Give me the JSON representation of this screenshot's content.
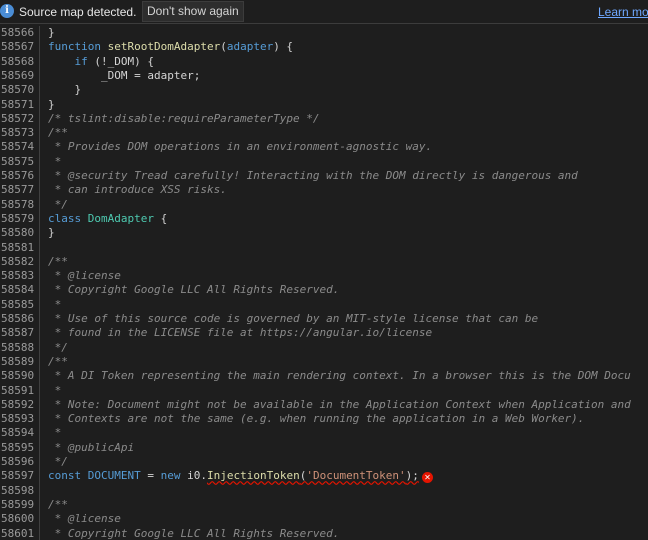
{
  "infobar": {
    "message": "Source map detected.",
    "dont_show_label": "Don't show again",
    "learn_more_label": "Learn mo"
  },
  "editor": {
    "lines": [
      {
        "n": "58566",
        "t": "    }",
        "k": "plain"
      },
      {
        "n": "58567",
        "t": "    function setRootDomAdapter(adapter) {",
        "k": "fn-decl"
      },
      {
        "n": "58568",
        "t": "        if (!_DOM) {",
        "k": "if"
      },
      {
        "n": "58569",
        "t": "            _DOM = adapter;",
        "k": "plain"
      },
      {
        "n": "58570",
        "t": "        }",
        "k": "plain"
      },
      {
        "n": "58571",
        "t": "    }",
        "k": "plain"
      },
      {
        "n": "58572",
        "t": "    /* tslint:disable:requireParameterType */",
        "k": "comment"
      },
      {
        "n": "58573",
        "t": "    /**",
        "k": "comment"
      },
      {
        "n": "58574",
        "t": "     * Provides DOM operations in an environment-agnostic way.",
        "k": "comment"
      },
      {
        "n": "58575",
        "t": "     *",
        "k": "comment"
      },
      {
        "n": "58576",
        "t": "     * @security Tread carefully! Interacting with the DOM directly is dangerous and",
        "k": "comment"
      },
      {
        "n": "58577",
        "t": "     * can introduce XSS risks.",
        "k": "comment"
      },
      {
        "n": "58578",
        "t": "     */",
        "k": "comment"
      },
      {
        "n": "58579",
        "t": "    class DomAdapter {",
        "k": "class"
      },
      {
        "n": "58580",
        "t": "    }",
        "k": "plain"
      },
      {
        "n": "58581",
        "t": "",
        "k": "plain"
      },
      {
        "n": "58582",
        "t": "    /**",
        "k": "comment"
      },
      {
        "n": "58583",
        "t": "     * @license",
        "k": "comment"
      },
      {
        "n": "58584",
        "t": "     * Copyright Google LLC All Rights Reserved.",
        "k": "comment"
      },
      {
        "n": "58585",
        "t": "     *",
        "k": "comment"
      },
      {
        "n": "58586",
        "t": "     * Use of this source code is governed by an MIT-style license that can be",
        "k": "comment"
      },
      {
        "n": "58587",
        "t": "     * found in the LICENSE file at https://angular.io/license",
        "k": "comment"
      },
      {
        "n": "58588",
        "t": "     */",
        "k": "comment"
      },
      {
        "n": "58589",
        "t": "    /**",
        "k": "comment"
      },
      {
        "n": "58590",
        "t": "     * A DI Token representing the main rendering context. In a browser this is the DOM Docu",
        "k": "comment"
      },
      {
        "n": "58591",
        "t": "     *",
        "k": "comment"
      },
      {
        "n": "58592",
        "t": "     * Note: Document might not be available in the Application Context when Application and",
        "k": "comment"
      },
      {
        "n": "58593",
        "t": "     * Contexts are not the same (e.g. when running the application in a Web Worker).",
        "k": "comment"
      },
      {
        "n": "58594",
        "t": "     *",
        "k": "comment"
      },
      {
        "n": "58595",
        "t": "     * @publicApi",
        "k": "comment"
      },
      {
        "n": "58596",
        "t": "     */",
        "k": "comment"
      },
      {
        "n": "58597",
        "t": "    const DOCUMENT = new i0.InjectionToken('DocumentToken');",
        "k": "error"
      },
      {
        "n": "58598",
        "t": "",
        "k": "plain"
      },
      {
        "n": "58599",
        "t": "    /**",
        "k": "comment"
      },
      {
        "n": "58600",
        "t": "     * @license",
        "k": "comment"
      },
      {
        "n": "58601",
        "t": "     * Copyright Google LLC All Rights Reserved.",
        "k": "comment"
      }
    ]
  },
  "colors": {
    "background": "#1e1e1e",
    "keyword": "#569cd6",
    "function": "#dcdcaa",
    "class": "#4ec9b0",
    "string": "#ce9178",
    "comment": "#8b8b8b",
    "error": "#e51400",
    "info_icon": "#4a8dd6",
    "link": "#6fa8ff"
  }
}
